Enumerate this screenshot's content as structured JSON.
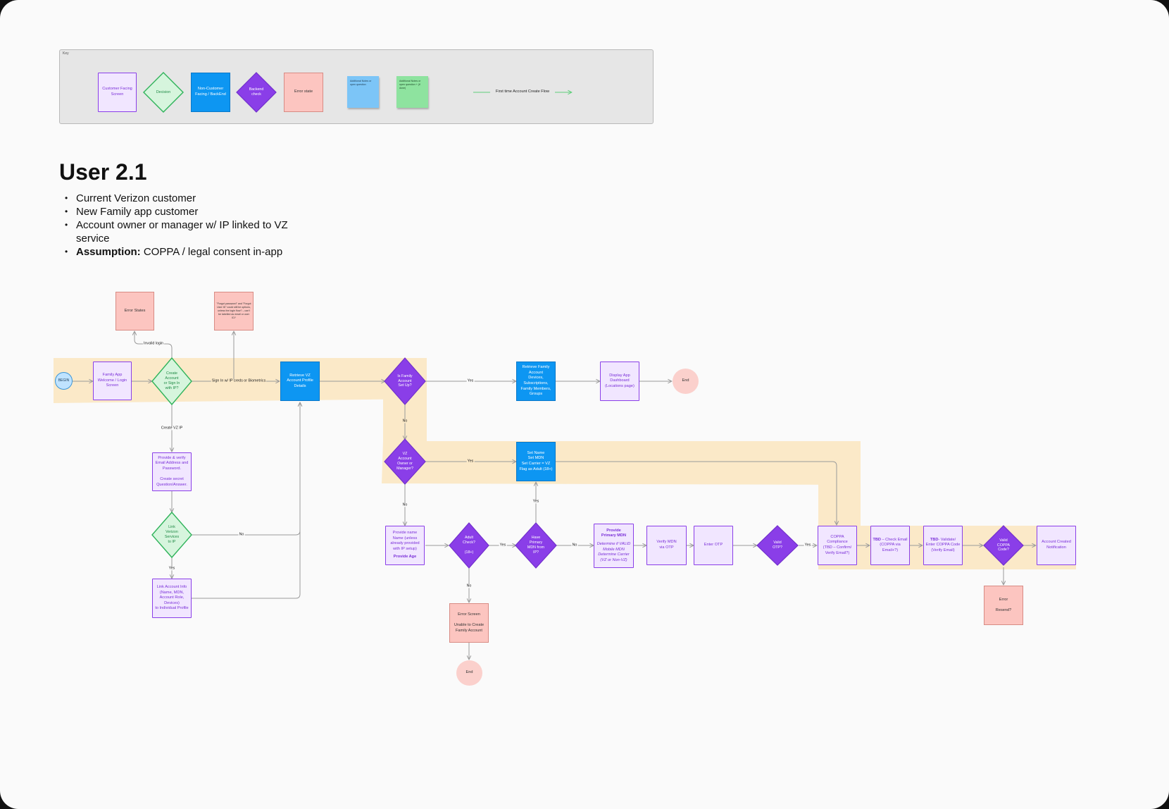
{
  "key": {
    "label": "Key",
    "customer_screen": "Customer Facing\nScreen",
    "decision": "Decision",
    "non_customer": "Non-Customer\nFacing / BackEnd",
    "backend_check": "Backend\ncheck",
    "error_state": "Error state",
    "note_blue": "Additional Notes or open question",
    "note_green": "Additional Notes or open question + (if done)",
    "flow": "First time Account Create Flow"
  },
  "title": "User 2.1",
  "bullets": [
    {
      "strong": "",
      "text": "Current Verizon customer"
    },
    {
      "strong": "",
      "text": "New Family app customer"
    },
    {
      "strong": "",
      "text": "Account owner or manager w/ IP linked to VZ service"
    },
    {
      "strong": "Assumption:",
      "text": " COPPA / legal consent in-app"
    }
  ],
  "nodes": {
    "begin": "BEGIN",
    "welcome": "Family App\nWelcome / Login\nScreen",
    "create_or_sign": "Create\nAccount\nor Sign In\nwith IP?",
    "error_states": "Error States",
    "forgot_note": "\"Forgot password\" and \"Forgot User ID\" could still be options, unless the login flow? – can't be labelled as email or user ID?",
    "retrieve_profile": "Retrieve VZ\nAccount Profile\nDetails",
    "family_setup": "Is Family\nAccount\nSet Up?",
    "retrieve_family": "Retrieve Family\nAccount\nDevices,\nSubscriptions,\nFamily Members,\nGroups",
    "display_dashboard": "Display App\nDashboard\n(Locations page)",
    "end1": "End",
    "provide_email": "Provide & verify\nEmail Address and\nPassword.\n\nCreate secret\nQuestion/Answer.",
    "link_services": "Link\nVerizon\nServices\nto IP",
    "link_account": "Link Account Info\n(Name, MDN,\nAccount Role,\nDevices)\nto Individual Profile",
    "vz_owner": "VZ\nAccount\nOwner or\nManager?",
    "set_name": "Set Name\nSet MDN\nSet Carrier = VZ\nFlag as Adult (18+)",
    "provide_name": "Provide name\nName (unless\nalready provided\nwith IP setup)",
    "provide_age": "Provide Age",
    "adult_check": "Adult\nCheck?\n\n(18+)",
    "primary_mdn": "Have\nPrimary\nMDN from\nIP?",
    "provide_mdn_title": "Provide\nPrimary MDN",
    "provide_mdn_body": "Determine if VALID\nMobile MDN\nDetermine Carrier\n(VZ or Non-VZ)",
    "verify_mdn": "Verify MDN\nvia OTP",
    "enter_otp": "Enter OTP",
    "valid_otp": "Valid\nOTP?",
    "coppa": "COPPA\nCompliance\n(TBD – Confirm/\nVerify Email?)",
    "check_email_tbd": "TBD",
    "check_email": " – Check Email\n(COPPA via\nEmail+?)",
    "validate_tbd": "TBD",
    "validate": "- Validate/\nEnter COPPA Code\n(Verify Email)",
    "valid_coppa": "Valid\nCOPPA\nCode?",
    "account_created": "Account Created\nNotification",
    "error_resend": "Error\n\nResend?",
    "error_screen": "Error Screen\n\nUnable to Create\nFamily Account",
    "end2": "End"
  },
  "edge_labels": {
    "invalid_login": "Invalid login",
    "sign_in_ip": "Sign In w/ IP creds or Biometrics",
    "create_vz_ip": "Create VZ IP",
    "yes_family": "Yes",
    "no_family": "No",
    "yes_owner": "Yes",
    "no_owner": "No",
    "no_link": "No",
    "yes_link": "Yes",
    "yes_adult": "Yes",
    "no_adult": "No",
    "yes_mdn": "Yes",
    "no_mdn": "No",
    "yes_otp": "Yes"
  },
  "colors": {
    "screen_fill": "#f1e6ff",
    "screen_border": "#8a3ee8",
    "decision_fill": "#d6f5dd",
    "decision_border": "#2fb35a",
    "backend_fill": "#8a3ee8",
    "system_fill": "#0d96f2",
    "error_fill": "#fcc5c0",
    "highlight": "#fbe9c8",
    "note_blue": "#7cc5f7",
    "note_green": "#8ee39f"
  }
}
